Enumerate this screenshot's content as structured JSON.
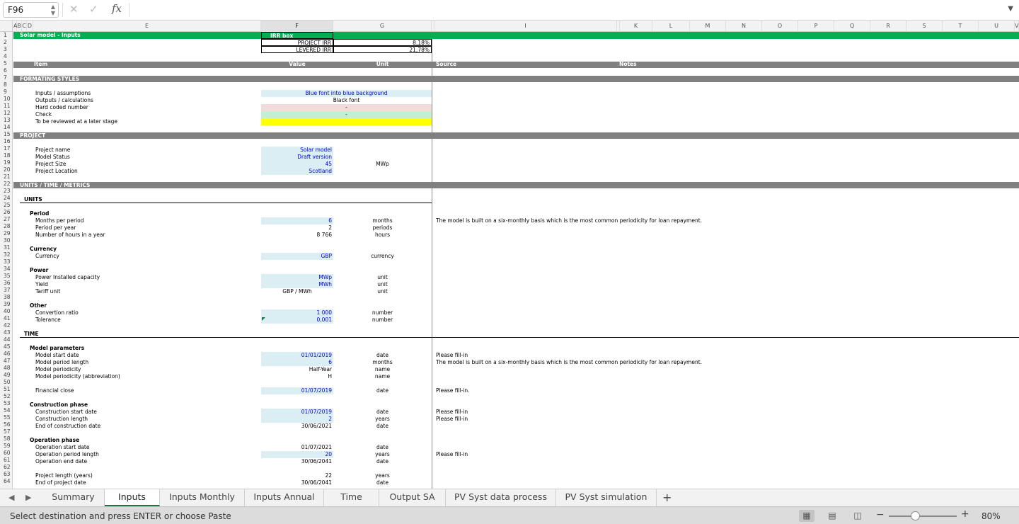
{
  "formula_bar": {
    "name_box": "F96",
    "cancel_icon": "✕",
    "confirm_icon": "✓",
    "fx_label": "fx",
    "formula": ""
  },
  "columns": [
    "A",
    "B",
    "C",
    "D",
    "E",
    "F",
    "G",
    "",
    "I",
    "",
    "K",
    "L",
    "M",
    "N",
    "O",
    "P",
    "Q",
    "R",
    "S",
    "T",
    "U",
    "V"
  ],
  "rows": [
    "1",
    "2",
    "3",
    "4",
    "5",
    "6",
    "7",
    "8",
    "9",
    "10",
    "11",
    "12",
    "13",
    "14",
    "15",
    "16",
    "17",
    "18",
    "19",
    "20",
    "21",
    "22",
    "23",
    "24",
    "25",
    "26",
    "27",
    "28",
    "29",
    "30",
    "31",
    "32",
    "33",
    "34",
    "35",
    "36",
    "37",
    "38",
    "39",
    "40",
    "41",
    "42",
    "43",
    "44",
    "45",
    "46",
    "47",
    "48",
    "49",
    "50",
    "51",
    "52",
    "53",
    "54",
    "55",
    "56",
    "57",
    "58",
    "59",
    "60",
    "61",
    "62",
    "63",
    "64"
  ],
  "header": {
    "title": "Solar model - Inputs",
    "irr_box": "IRR box",
    "project_irr_label": "PROJECT IRR",
    "project_irr": "8,18%",
    "levered_irr_label": "LEVERED IRR",
    "levered_irr": "21,78%"
  },
  "col_titles": {
    "item": "Item",
    "value": "Value",
    "unit": "Unit",
    "source": "Source",
    "notes": "Notes"
  },
  "formatting": {
    "section": "FORMATING STYLES",
    "inputs": "Inputs / assumptions",
    "inputs_value": "Blue font into blue background",
    "outputs": "Outputs / calculations",
    "outputs_value": "Black font",
    "hardcoded": "Hard coded number",
    "hardcoded_value": "-",
    "check": "Check",
    "check_value": "-",
    "review": "To be reviewed at a later stage"
  },
  "project": {
    "section": "PROJECT",
    "name_label": "Project name",
    "name_value": "Solar model",
    "status_label": "Model Status",
    "status_value": "Draft version",
    "size_label": "Project Size",
    "size_value": "45",
    "size_unit": "MWp",
    "location_label": "Project Location",
    "location_value": "Scotland"
  },
  "units_section": "UNITS / TIME / METRICS",
  "units": {
    "heading": "UNITS",
    "period": "Period",
    "months_label": "Months per period",
    "months_value": "6",
    "months_unit": "months",
    "periodicity_note": "The model is built on a six-monthly basis which is the most common periodicity for loan repayment.",
    "pery_label": "Period per year",
    "pery_value": "2",
    "pery_unit": "periods",
    "hours_label": "Number of hours in a year",
    "hours_value": "8 766",
    "hours_unit": "hours",
    "currency": "Currency",
    "currency_label": "Currency",
    "currency_value": "GBP",
    "currency_unit": "currency",
    "power": "Power",
    "capacity_label": "Power Installed capacity",
    "capacity_value": "MWp",
    "capacity_unit": "unit",
    "yield_label": "Yield",
    "yield_value": "MWh",
    "yield_unit": "unit",
    "tariff_label": "Tariff unit",
    "tariff_value": "GBP / MWh",
    "tariff_unit": "unit",
    "other": "Other",
    "conversion_label": "Convertion ratio",
    "conversion_value": "1 000",
    "conversion_unit": "number",
    "tolerance_label": "Tolerance",
    "tolerance_value": "0,001",
    "tolerance_unit": "number"
  },
  "time": {
    "heading": "TIME",
    "model_params": "Model parameters",
    "start_label": "Model start date",
    "start_value": "01/01/2019",
    "start_unit": "date",
    "start_note": "Please fill-in",
    "length_label": "Model period length",
    "length_value": "6",
    "length_unit": "months",
    "length_note": "The model is built on a six-monthly basis which is the most common periodicity for loan repayment.",
    "period_label": "Model periodicity",
    "period_value": "Half-Year",
    "period_unit": "name",
    "abbr_label": "Model periodicity (abbreviation)",
    "abbr_value": "H",
    "abbr_unit": "name",
    "fc_label": "Financial close",
    "fc_value": "01/07/2019",
    "fc_unit": "date",
    "fc_note": "Please fill-in.",
    "construction": "Construction phase",
    "cstart_label": "Construction start date",
    "cstart_value": "01/07/2019",
    "cstart_unit": "date",
    "cstart_note": "Please fill-in",
    "clength_label": "Construction length",
    "clength_value": "2",
    "clength_unit": "years",
    "clength_note": "Please fill-in",
    "cend_label": "End of construction date",
    "cend_value": "30/06/2021",
    "cend_unit": "date",
    "operation": "Operation phase",
    "ostart_label": "Operation start date",
    "ostart_value": "01/07/2021",
    "ostart_unit": "date",
    "olength_label": "Operation period length",
    "olength_value": "20",
    "olength_unit": "years",
    "olength_note": "Please fill-in",
    "oend_label": "Operation end date",
    "oend_value": "30/06/2041",
    "oend_unit": "date",
    "plength_label": "Project length (years)",
    "plength_value": "22",
    "plength_unit": "years",
    "pend_label": "End of project date",
    "pend_value": "30/06/2041",
    "pend_unit": "date"
  },
  "tabs": [
    "Summary",
    "Inputs",
    "Inputs Monthly",
    "Inputs Annual",
    "Time",
    "Output SA",
    "PV Syst data process",
    "PV Syst simulation"
  ],
  "add_tab": "+",
  "status": {
    "message": "Select destination and press ENTER or choose Paste",
    "zoom": "80%"
  },
  "colors": {
    "green": "#00b050",
    "gray": "#808080",
    "input_blue": "#daeef3",
    "hardcoded_pink": "#f2dcdb",
    "check_green": "#c6efce",
    "review_yellow": "#ffff00"
  }
}
